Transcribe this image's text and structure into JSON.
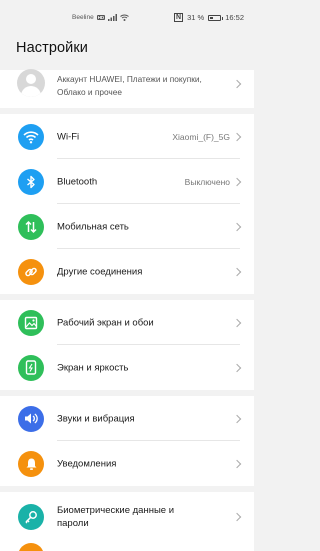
{
  "status_bar": {
    "carrier": "Beeline",
    "carrier_badge": "HD",
    "nfc": "N",
    "battery": "31 %",
    "battery_level": 0.31,
    "time": "16:52"
  },
  "header": {
    "title": "Настройки"
  },
  "account": {
    "text": "Аккаунт HUAWEI, Платежи и покупки, Облако и прочее"
  },
  "sections": [
    {
      "items": [
        {
          "label": "Wi-Fi",
          "value": "Xiaomi_(F)_5G",
          "icon": "wifi-icon",
          "color": "#1e9ff2"
        },
        {
          "label": "Bluetooth",
          "value": "Выключено",
          "icon": "bluetooth-icon",
          "color": "#1e9ff2"
        },
        {
          "label": "Мобильная сеть",
          "value": "",
          "icon": "mobile-data-icon",
          "color": "#2fbf5a"
        },
        {
          "label": "Другие соединения",
          "value": "",
          "icon": "link-icon",
          "color": "#f5910e"
        }
      ]
    },
    {
      "items": [
        {
          "label": "Рабочий экран и обои",
          "value": "",
          "icon": "wallpaper-icon",
          "color": "#2fbf5a"
        },
        {
          "label": "Экран и яркость",
          "value": "",
          "icon": "display-icon",
          "color": "#2fbf5a"
        }
      ]
    },
    {
      "items": [
        {
          "label": "Звуки и вибрация",
          "value": "",
          "icon": "sound-icon",
          "color": "#3c6ee8"
        },
        {
          "label": "Уведомления",
          "value": "",
          "icon": "bell-icon",
          "color": "#f5910e"
        }
      ]
    },
    {
      "items": [
        {
          "label": "Биометрические данные и пароли",
          "value": "",
          "icon": "key-icon",
          "color": "#1ab2a8"
        }
      ]
    }
  ]
}
